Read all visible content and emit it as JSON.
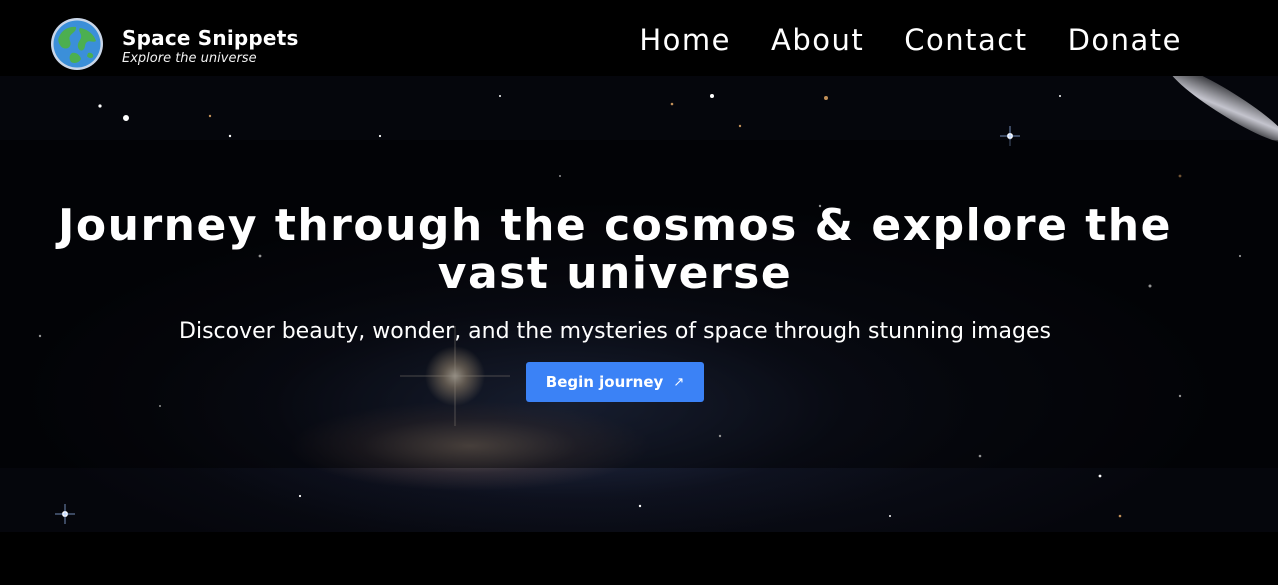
{
  "brand": {
    "title": "Space Snippets",
    "tagline": "Explore the universe",
    "logo_icon": "earth-globe-icon"
  },
  "nav": {
    "items": [
      {
        "label": "Home"
      },
      {
        "label": "About"
      },
      {
        "label": "Contact"
      },
      {
        "label": "Donate"
      }
    ]
  },
  "hero": {
    "headline": "Journey through the cosmos & explore the vast universe",
    "subheadline": "Discover beauty, wonder, and the mysteries of space through stunning images",
    "cta_label": "Begin journey",
    "cta_icon": "arrow-up-right-icon",
    "cta_icon_glyph": "↗",
    "background_image": "galaxy-starfield"
  },
  "colors": {
    "header_bg": "#000000",
    "cta_bg": "#3b82f6",
    "text": "#ffffff"
  }
}
